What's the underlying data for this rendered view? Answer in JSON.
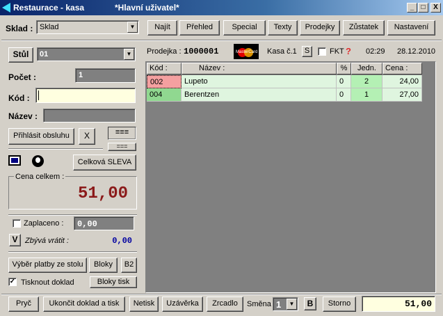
{
  "window": {
    "app_title": "Restaurace - kasa",
    "doc_title": "*Hlavní uživatel*",
    "min_label": "_",
    "max_label": "□",
    "close_label": "X"
  },
  "toolbar": {
    "sklad_label": "Sklad :",
    "sklad_value": "Sklad",
    "buttons": [
      "Najít",
      "Přehled",
      "Special",
      "Texty",
      "Prodejky",
      "Zůstatek",
      "Nastavení"
    ]
  },
  "left": {
    "stul_button": "Stůl",
    "stul_value": "01",
    "pocet_label": "Počet :",
    "pocet_value": "1",
    "kod_label": "Kód :",
    "kod_value": "",
    "nazev_label": "Název :",
    "nazev_value": "",
    "login_button": "Přihlásit obsluhu",
    "x_button": "X",
    "layout_button_1": "≡≡≡",
    "layout_button_2": "===",
    "discount_button": "Celková SLEVA",
    "total_label": "Cena celkem :",
    "total_value": "51,00",
    "paid_label": "Zaplaceno :",
    "paid_value": "0,00",
    "v_button": "V",
    "change_label": "Zbývá vrátit :",
    "change_value": "0,00",
    "pay_from_table_button": "Výběr platby ze stolu",
    "bloky_button": "Bloky",
    "b2_button": "B2",
    "print_label": "Tisknout doklad",
    "print_checked": true,
    "bloky_tisk_button": "Bloky tisk"
  },
  "info": {
    "prodejka_label": "Prodejka :",
    "prodejka_value": "1000001",
    "card_logo_text": "MasterCard",
    "kasa_label": "Kasa č.1",
    "s_button": "S",
    "fkt_label": "FKT",
    "help_icon": "?",
    "time": "02:29",
    "date": "28.12.2010"
  },
  "grid": {
    "headers": [
      "Kód :",
      "Název :",
      "%",
      "Jedn.",
      "Cena :"
    ],
    "rows": [
      {
        "code": "002",
        "name": "Lupeto",
        "pct": "0",
        "unit": "2",
        "price": "24,00"
      },
      {
        "code": "004",
        "name": "Berentzen",
        "pct": "0",
        "unit": "1",
        "price": "27,00"
      }
    ]
  },
  "bottom": {
    "buttons": [
      "Pryč",
      "Ukončit doklad a tisk",
      "Netisk",
      "Uzávěrka",
      "Zrcadlo"
    ],
    "smena_label": "Směna",
    "smena_value": "1",
    "b_button": "B",
    "storno_button": "Storno",
    "total_value": "51,00"
  },
  "colors": {
    "titlebar_start": "#0a246a",
    "code_row1": "#f4a0a0",
    "code_row2": "#90d890",
    "row_bg": "#dff5df",
    "unit_bg": "#b4f0b4",
    "total_red": "#8b1a1a",
    "change_blue": "#0000a0"
  }
}
